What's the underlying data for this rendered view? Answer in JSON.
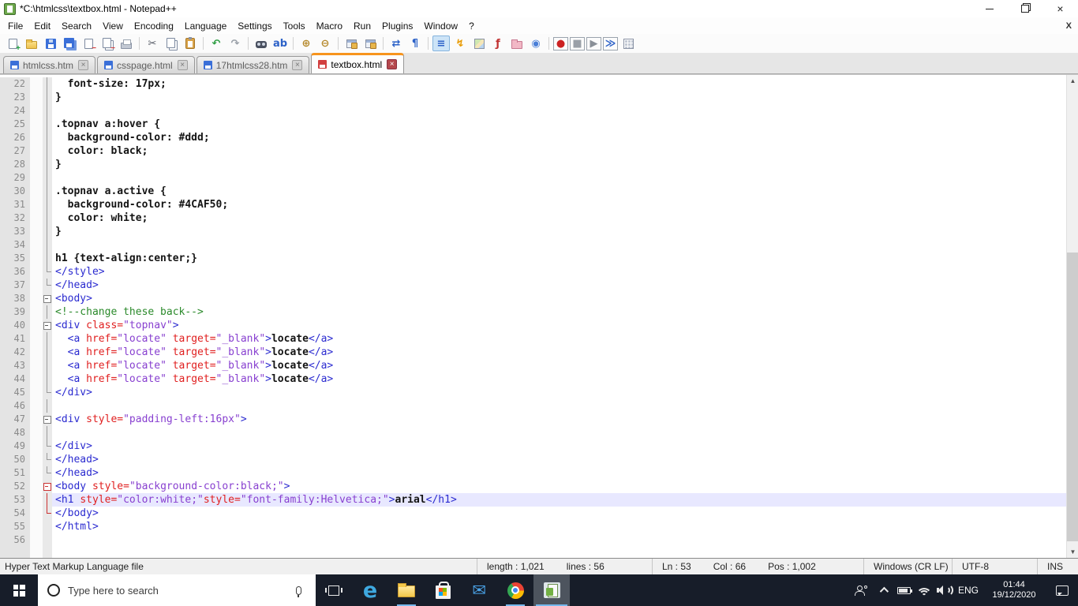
{
  "window": {
    "title": "*C:\\htmlcss\\textbox.html - Notepad++"
  },
  "menu": {
    "items": [
      "File",
      "Edit",
      "Search",
      "View",
      "Encoding",
      "Language",
      "Settings",
      "Tools",
      "Macro",
      "Run",
      "Plugins",
      "Window",
      "?"
    ],
    "close_label": "X"
  },
  "toolbar": {
    "groups": [
      [
        {
          "name": "new-file-icon",
          "kind": "page",
          "badge": "+",
          "badgeClass": "bg-green"
        },
        {
          "name": "open-file-icon",
          "kind": "folder"
        },
        {
          "name": "save-icon",
          "kind": "floppy"
        },
        {
          "name": "save-all-icon",
          "kind": "floppy2"
        },
        {
          "name": "close-file-icon",
          "kind": "page",
          "badge": "−",
          "badgeClass": "bg-red"
        },
        {
          "name": "close-all-files-icon",
          "kind": "page2",
          "badge": "−",
          "badgeClass": "bg-red"
        },
        {
          "name": "print-icon",
          "kind": "printer"
        }
      ],
      [
        {
          "name": "cut-icon",
          "glyph": "✂",
          "color": "#555b66"
        },
        {
          "name": "copy-icon",
          "kind": "page2"
        },
        {
          "name": "paste-icon",
          "kind": "clip"
        }
      ],
      [
        {
          "name": "undo-icon",
          "glyph": "↶",
          "color": "#2f9e44"
        },
        {
          "name": "redo-icon",
          "glyph": "↷",
          "color": "#9aa0a8"
        }
      ],
      [
        {
          "name": "find-icon",
          "kind": "binoc"
        },
        {
          "name": "replace-icon",
          "glyph": "ab",
          "color": "#2d62c8"
        }
      ],
      [
        {
          "name": "zoom-in-icon",
          "glyph": "⊕",
          "color": "#b5882a"
        },
        {
          "name": "zoom-out-icon",
          "glyph": "⊖",
          "color": "#b5882a"
        }
      ],
      [
        {
          "name": "sync-vertical-scrolling-icon",
          "kind": "winlock"
        },
        {
          "name": "sync-horizontal-scrolling-icon",
          "kind": "winlock"
        }
      ],
      [
        {
          "name": "word-wrap-icon",
          "glyph": "⇄",
          "color": "#2d62c8"
        },
        {
          "name": "show-all-characters-icon",
          "glyph": "¶",
          "color": "#2d62c8"
        }
      ],
      [
        {
          "name": "indent-guide-icon",
          "glyph": "≡",
          "color": "#2d62c8",
          "active": true
        },
        {
          "name": "function-completion-icon",
          "glyph": "↯",
          "color": "#e89a00"
        },
        {
          "name": "document-map-icon",
          "kind": "map"
        },
        {
          "name": "function-list-icon",
          "glyph": "ƒ",
          "color": "#c03030"
        },
        {
          "name": "folder-as-workspace-icon",
          "kind": "folderpink"
        },
        {
          "name": "document-monitor-icon",
          "glyph": "◉",
          "color": "#4a7fd8"
        }
      ],
      [
        {
          "name": "record-macro-icon",
          "glyph": "●",
          "color": "#cc2222",
          "boxed": true
        },
        {
          "name": "stop-macro-icon",
          "glyph": "■",
          "color": "#9aa0a8",
          "boxed": true
        },
        {
          "name": "play-macro-icon",
          "glyph": "▶",
          "color": "#8a9098",
          "boxed": true
        },
        {
          "name": "run-macro-multiple-times-icon",
          "glyph": "≫",
          "color": "#2d62c8",
          "boxed": true
        },
        {
          "name": "save-recorded-macro-icon",
          "kind": "grid"
        }
      ]
    ]
  },
  "tabs": [
    {
      "label": "htmlcss.htm",
      "active": false,
      "modified": false
    },
    {
      "label": "csspage.html",
      "active": false,
      "modified": false
    },
    {
      "label": "17htmlcss28.htm",
      "active": false,
      "modified": false
    },
    {
      "label": "textbox.html",
      "active": true,
      "modified": true
    }
  ],
  "editor": {
    "lines": [
      {
        "n": 22,
        "f": "v",
        "t": [
          [
            "css",
            "  font-size: 17px;"
          ]
        ]
      },
      {
        "n": 23,
        "f": "v",
        "t": [
          [
            "css",
            "}"
          ]
        ]
      },
      {
        "n": 24,
        "f": "v",
        "t": []
      },
      {
        "n": 25,
        "f": "v",
        "t": [
          [
            "css",
            ".topnav a:hover {"
          ]
        ]
      },
      {
        "n": 26,
        "f": "v",
        "t": [
          [
            "css",
            "  background-color: #ddd;"
          ]
        ]
      },
      {
        "n": 27,
        "f": "v",
        "t": [
          [
            "css",
            "  color: black;"
          ]
        ]
      },
      {
        "n": 28,
        "f": "v",
        "t": [
          [
            "css",
            "}"
          ]
        ]
      },
      {
        "n": 29,
        "f": "v",
        "t": []
      },
      {
        "n": 30,
        "f": "v",
        "t": [
          [
            "css",
            ".topnav a.active {"
          ]
        ]
      },
      {
        "n": 31,
        "f": "v",
        "t": [
          [
            "css",
            "  background-color: #4CAF50;"
          ]
        ]
      },
      {
        "n": 32,
        "f": "v",
        "t": [
          [
            "css",
            "  color: white;"
          ]
        ]
      },
      {
        "n": 33,
        "f": "v",
        "t": [
          [
            "css",
            "}"
          ]
        ]
      },
      {
        "n": 34,
        "f": "v",
        "t": []
      },
      {
        "n": 35,
        "f": "v",
        "t": [
          [
            "css",
            "h1 {text-align:center;}"
          ]
        ]
      },
      {
        "n": 36,
        "f": "c",
        "t": [
          [
            "tag",
            "</style>"
          ]
        ]
      },
      {
        "n": 37,
        "f": "c",
        "t": [
          [
            "tag",
            "</head>"
          ]
        ]
      },
      {
        "n": 38,
        "f": "box",
        "t": [
          [
            "tag",
            "<body>"
          ]
        ]
      },
      {
        "n": 39,
        "f": "v",
        "t": [
          [
            "com",
            "<!--change these back-->"
          ]
        ]
      },
      {
        "n": 40,
        "f": "box",
        "t": [
          [
            "tag",
            "<div "
          ],
          [
            "att",
            "class="
          ],
          [
            "val",
            "\"topnav\""
          ],
          [
            "tag",
            ">"
          ]
        ]
      },
      {
        "n": 41,
        "f": "v",
        "t": [
          [
            "txt",
            "  "
          ],
          [
            "tag",
            "<a "
          ],
          [
            "att",
            "href="
          ],
          [
            "val",
            "\"locate\""
          ],
          [
            "txt",
            " "
          ],
          [
            "att",
            "target="
          ],
          [
            "val",
            "\"_blank\""
          ],
          [
            "tag",
            ">"
          ],
          [
            "txt",
            "locate"
          ],
          [
            "tag",
            "</a>"
          ]
        ]
      },
      {
        "n": 42,
        "f": "v",
        "t": [
          [
            "txt",
            "  "
          ],
          [
            "tag",
            "<a "
          ],
          [
            "att",
            "href="
          ],
          [
            "val",
            "\"locate\""
          ],
          [
            "txt",
            " "
          ],
          [
            "att",
            "target="
          ],
          [
            "val",
            "\"_blank\""
          ],
          [
            "tag",
            ">"
          ],
          [
            "txt",
            "locate"
          ],
          [
            "tag",
            "</a>"
          ]
        ]
      },
      {
        "n": 43,
        "f": "v",
        "t": [
          [
            "txt",
            "  "
          ],
          [
            "tag",
            "<a "
          ],
          [
            "att",
            "href="
          ],
          [
            "val",
            "\"locate\""
          ],
          [
            "txt",
            " "
          ],
          [
            "att",
            "target="
          ],
          [
            "val",
            "\"_blank\""
          ],
          [
            "tag",
            ">"
          ],
          [
            "txt",
            "locate"
          ],
          [
            "tag",
            "</a>"
          ]
        ]
      },
      {
        "n": 44,
        "f": "v",
        "t": [
          [
            "txt",
            "  "
          ],
          [
            "tag",
            "<a "
          ],
          [
            "att",
            "href="
          ],
          [
            "val",
            "\"locate\""
          ],
          [
            "txt",
            " "
          ],
          [
            "att",
            "target="
          ],
          [
            "val",
            "\"_blank\""
          ],
          [
            "tag",
            ">"
          ],
          [
            "txt",
            "locate"
          ],
          [
            "tag",
            "</a>"
          ]
        ]
      },
      {
        "n": 45,
        "f": "c",
        "t": [
          [
            "tag",
            "</div>"
          ]
        ]
      },
      {
        "n": 46,
        "f": "v",
        "t": []
      },
      {
        "n": 47,
        "f": "box",
        "t": [
          [
            "tag",
            "<div "
          ],
          [
            "att",
            "style="
          ],
          [
            "val",
            "\"padding-left:16px\""
          ],
          [
            "tag",
            ">"
          ]
        ]
      },
      {
        "n": 48,
        "f": "v",
        "t": []
      },
      {
        "n": 49,
        "f": "c",
        "t": [
          [
            "tag",
            "</div>"
          ]
        ]
      },
      {
        "n": 50,
        "f": "c",
        "t": [
          [
            "tag",
            "</head>"
          ]
        ]
      },
      {
        "n": 51,
        "f": "c",
        "t": [
          [
            "tag",
            "</head>"
          ]
        ]
      },
      {
        "n": 52,
        "f": "boxr",
        "t": [
          [
            "tag",
            "<body "
          ],
          [
            "att",
            "style="
          ],
          [
            "val",
            "\"background-color:black;\""
          ],
          [
            "tag",
            ">"
          ]
        ]
      },
      {
        "n": 53,
        "f": "vr",
        "hl": true,
        "t": [
          [
            "tag",
            "<h1 "
          ],
          [
            "att",
            "style="
          ],
          [
            "val",
            "\"color:white;\""
          ],
          [
            "att",
            "style="
          ],
          [
            "val",
            "\"font-family:Helvetica;\""
          ],
          [
            "tag",
            ">"
          ],
          [
            "txt",
            "arial"
          ],
          [
            "tag",
            "</h1>"
          ]
        ]
      },
      {
        "n": 54,
        "f": "cr",
        "t": [
          [
            "tag",
            "</body>"
          ]
        ]
      },
      {
        "n": 55,
        "f": "",
        "t": [
          [
            "tag",
            "</html>"
          ]
        ]
      },
      {
        "n": 56,
        "f": "",
        "t": []
      }
    ]
  },
  "statusbar": {
    "doctype": "Hyper Text Markup Language file",
    "length_label": "length : 1,021",
    "lines_label": "lines : 56",
    "ln": "Ln : 53",
    "col": "Col : 66",
    "pos": "Pos : 1,002",
    "eol": "Windows (CR LF)",
    "encoding": "UTF-8",
    "mode": "INS"
  },
  "taskbar": {
    "search_placeholder": "Type here to search",
    "apps": [
      {
        "name": "edge",
        "cls": "app-edge",
        "glyph": "e",
        "running": false,
        "active": false
      },
      {
        "name": "file-explorer",
        "cls": "app-explorer",
        "running": true,
        "active": false
      },
      {
        "name": "microsoft-store",
        "cls": "app-store",
        "running": false,
        "active": false
      },
      {
        "name": "mail",
        "cls": "app-mail",
        "glyph": "✉",
        "running": false,
        "active": false
      },
      {
        "name": "chrome",
        "cls": "app-chrome",
        "running": true,
        "active": false
      },
      {
        "name": "notepad-plus-plus",
        "cls": "app-npp",
        "running": true,
        "active": true
      }
    ],
    "lang": "ENG",
    "time": "01:44",
    "date": "19/12/2020"
  },
  "colors": {
    "accent_orange_tab": "#f7941d",
    "taskbar_bg": "#171d29",
    "underline_blue": "#76b9ed",
    "current_line_bg": "#e8e8ff",
    "tag_blue": "#2b2bd0",
    "attribute_red": "#e02020",
    "value_purple": "#8840d0",
    "comment_green": "#2b8a2b"
  }
}
